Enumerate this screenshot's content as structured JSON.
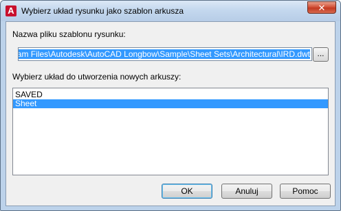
{
  "window": {
    "title": "Wybierz układ rysunku jako szablon arkusza",
    "app_icon_glyph": "A",
    "close_glyph": "✕"
  },
  "form": {
    "template_file_label": "Nazwa pliku szablonu rysunku:",
    "template_file_value": "\\Program Files\\Autodesk\\AutoCAD Longbow\\Sample\\Sheet Sets\\Architectural\\IRD.dwt",
    "browse_label": "...",
    "layout_label": "Wybierz układ do utworzenia nowych arkuszy:",
    "layouts": [
      "SAVED",
      "Sheet"
    ],
    "selected_layout": "Sheet"
  },
  "buttons": {
    "ok": "OK",
    "cancel": "Anuluj",
    "help": "Pomoc"
  },
  "colors": {
    "selection": "#3399ff",
    "close_button": "#c23a22",
    "app_icon": "#c8102e"
  }
}
